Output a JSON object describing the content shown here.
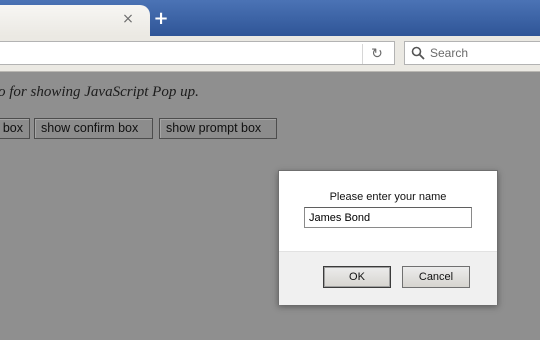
{
  "browser": {
    "tab": {
      "close_glyph": "×"
    },
    "new_tab_glyph": "+",
    "url": {
      "value": ""
    },
    "reload_glyph": "↻",
    "search": {
      "placeholder": "Search",
      "icon": "search-icon"
    }
  },
  "page": {
    "intro_text": "o for showing JavaScript Pop up.",
    "buttons": [
      {
        "label": "box"
      },
      {
        "label": "show confirm box"
      },
      {
        "label": "show prompt box"
      }
    ]
  },
  "dialog": {
    "message": "Please enter your name",
    "input_value": "James Bond",
    "ok_label": "OK",
    "cancel_label": "Cancel"
  }
}
